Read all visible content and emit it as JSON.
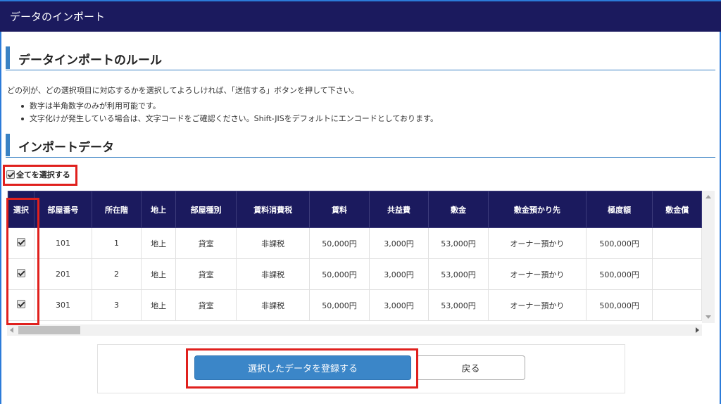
{
  "window": {
    "title": "データのインポート"
  },
  "rules_section": {
    "heading": "データインポートのルール",
    "intro": "どの列が、どの選択項目に対応するかを選択してよろしければ、「送信する」ボタンを押して下さい。",
    "rules": [
      "数字は半角数字のみが利用可能です。",
      "文字化けが発生している場合は、文字コードをご確認ください。Shift-JISをデフォルトにエンコードとしております。"
    ]
  },
  "import_section": {
    "heading": "インポートデータ",
    "select_all_label": "全てを選択する",
    "select_all_checked": true
  },
  "table": {
    "columns": [
      "選択",
      "部屋番号",
      "所在階",
      "地上",
      "部屋種別",
      "賃料消費税",
      "賃料",
      "共益費",
      "敷金",
      "敷金預かり先",
      "極度額",
      "敷金償"
    ],
    "rows": [
      {
        "checked": true,
        "cells": [
          "101",
          "1",
          "地上",
          "貸室",
          "非課税",
          "50,000円",
          "3,000円",
          "53,000円",
          "オーナー預かり",
          "500,000円",
          ""
        ]
      },
      {
        "checked": true,
        "cells": [
          "201",
          "2",
          "地上",
          "貸室",
          "非課税",
          "50,000円",
          "3,000円",
          "53,000円",
          "オーナー預かり",
          "500,000円",
          ""
        ]
      },
      {
        "checked": true,
        "cells": [
          "301",
          "3",
          "地上",
          "貸室",
          "非課税",
          "50,000円",
          "3,000円",
          "53,000円",
          "オーナー預かり",
          "500,000円",
          ""
        ]
      }
    ]
  },
  "buttons": {
    "register_label": "選択したデータを登録する",
    "back_label": "戻る"
  },
  "colors": {
    "header_bg": "#1b1a5e",
    "accent_blue": "#3a82c4",
    "primary_button": "#3b86c8",
    "highlight_red": "#e0201d"
  }
}
